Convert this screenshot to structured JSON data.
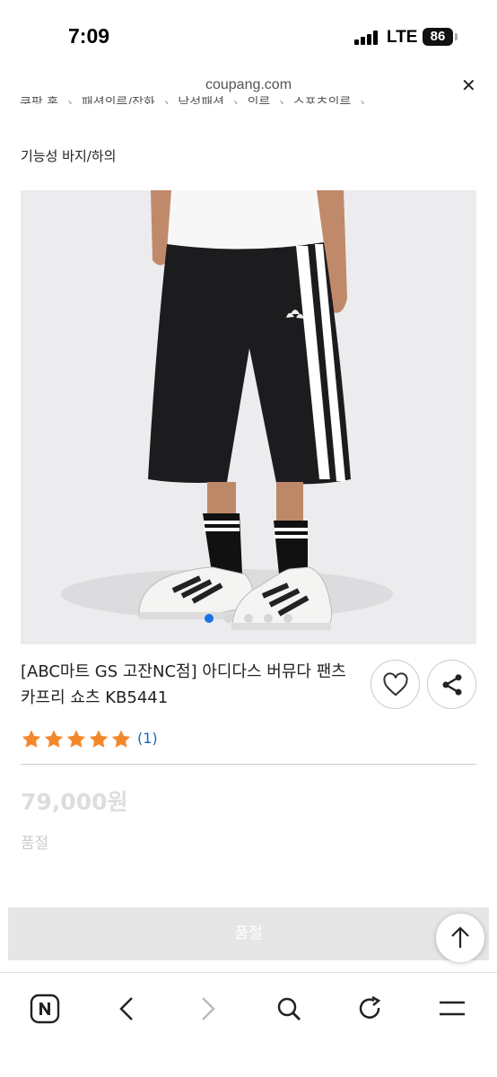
{
  "status_bar": {
    "time": "7:09",
    "network": "LTE",
    "battery": "86"
  },
  "browser": {
    "url": "coupang.com"
  },
  "breadcrumb": [
    "쿠팡 홈",
    "패션의류/잡화",
    "남성패션",
    "의류",
    "스포츠의류"
  ],
  "product": {
    "category": "기능성 바지/하의",
    "title": "[ABC마트 GS 고잔NC점] 아디다스 버뮤다 팬츠 카프리 쇼츠 KB5441",
    "rating": 5,
    "review_count": "(1)",
    "price": "79,000원",
    "status": "품절",
    "image_count": 5,
    "active_image": 1
  },
  "buy_button": {
    "label": "품절"
  },
  "icons": {
    "wishlist": "heart-icon",
    "share": "share-icon",
    "scroll_top": "arrow-up-icon",
    "naver": "naver-n-icon",
    "back": "chevron-left-icon",
    "forward": "chevron-right-icon",
    "search": "search-icon",
    "reload": "reload-icon",
    "menu": "menu-icon"
  },
  "colors": {
    "star": "#f5872b",
    "link": "#1565c0",
    "active_dot": "#1a73e8"
  }
}
